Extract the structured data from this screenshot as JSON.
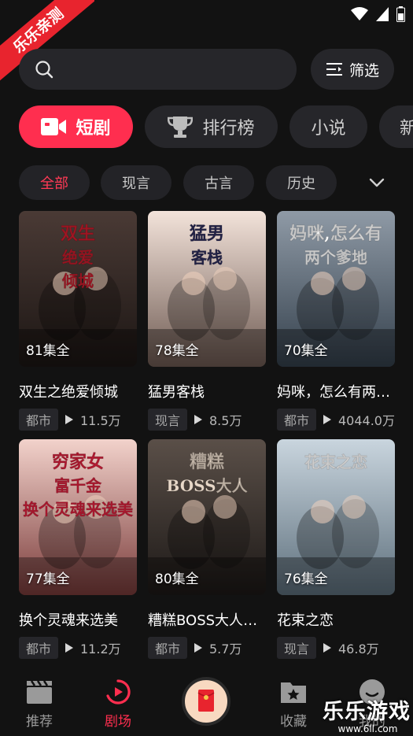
{
  "status": {
    "ribbon": "乐乐亲测"
  },
  "search": {
    "placeholder": ""
  },
  "filter": {
    "label": "筛选"
  },
  "main_tabs": [
    {
      "label": "短剧",
      "active": true
    },
    {
      "label": "排行榜",
      "active": false
    },
    {
      "label": "小说",
      "active": false
    },
    {
      "label": "新",
      "active": false
    }
  ],
  "genres": [
    {
      "label": "全部",
      "active": true
    },
    {
      "label": "现言",
      "active": false
    },
    {
      "label": "古言",
      "active": false
    },
    {
      "label": "历史",
      "active": false
    }
  ],
  "dramas": [
    {
      "title": "双生之绝爱倾城",
      "episodes": "81集全",
      "genre": "都市",
      "views": "11.5万"
    },
    {
      "title": "猛男客栈",
      "episodes": "78集全",
      "genre": "现言",
      "views": "8.5万"
    },
    {
      "title": "妈咪，怎么有两个爹地",
      "episodes": "70集全",
      "genre": "都市",
      "views": "4044.0万"
    },
    {
      "title": "换个灵魂来选美",
      "episodes": "77集全",
      "genre": "都市",
      "views": "11.2万"
    },
    {
      "title": "糟糕BOSS大人太撩人",
      "episodes": "80集全",
      "genre": "都市",
      "views": "5.7万"
    },
    {
      "title": "花束之恋",
      "episodes": "76集全",
      "genre": "现言",
      "views": "46.8万"
    }
  ],
  "posters": [
    {
      "lines": [
        "双生",
        "绝爱",
        "倾城"
      ],
      "colors": [
        "#4a3a35",
        "#1c1614"
      ],
      "accent": "#c41b2b"
    },
    {
      "lines": [
        "猛男",
        "客栈"
      ],
      "colors": [
        "#f3e3da",
        "#6e5a52"
      ],
      "accent": "#2b2b58"
    },
    {
      "lines": [
        "妈咪,怎么有",
        "两个爹地"
      ],
      "colors": [
        "#8f9aa6",
        "#34404c"
      ],
      "accent": "#ffffff"
    },
    {
      "lines": [
        "穷家女",
        "富千金",
        "换个灵魂来选美"
      ],
      "colors": [
        "#f2d2cb",
        "#7a3b3a"
      ],
      "accent": "#d61e3a"
    },
    {
      "lines": [
        "糟糕",
        "BOSS大人"
      ],
      "colors": [
        "#5a4f48",
        "#1d1917"
      ],
      "accent": "#e8d8c8"
    },
    {
      "lines": [
        "花束之恋"
      ],
      "colors": [
        "#c9d5de",
        "#5d6f7c"
      ],
      "accent": "#ffffff"
    }
  ],
  "nav": [
    {
      "label": "推荐",
      "active": false
    },
    {
      "label": "剧场",
      "active": true
    },
    {
      "label": "",
      "active": false
    },
    {
      "label": "收藏",
      "active": false
    },
    {
      "label": "我的",
      "active": false
    }
  ],
  "watermark": {
    "brand": "乐乐游戏",
    "url": "www.6ll.com"
  },
  "colors": {
    "accent": "#ff2e4f",
    "background": "#121212",
    "surface": "#26262a"
  }
}
